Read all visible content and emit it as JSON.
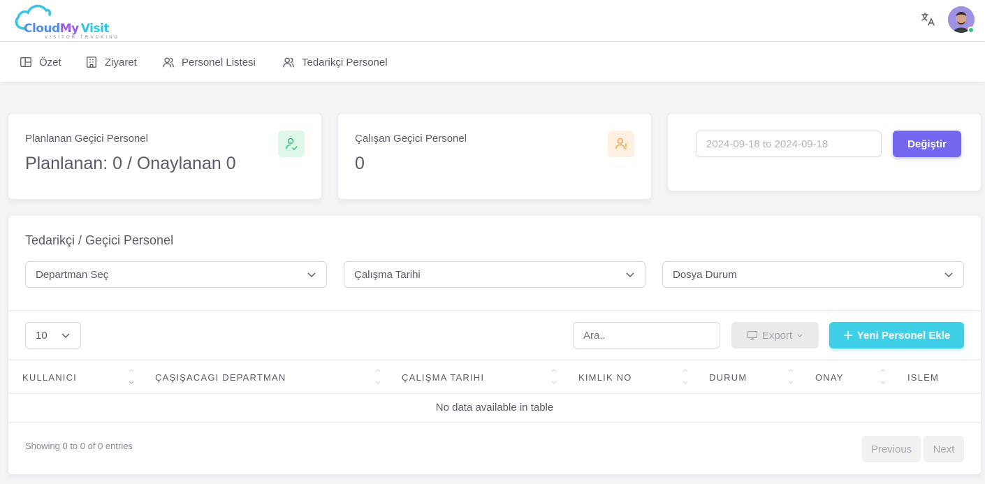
{
  "brand": {
    "name_part1": "Cloud",
    "name_part2": "My",
    "name_part3": "Visit",
    "tagline": "VISITOR TRACKING"
  },
  "header": {
    "translate_icon": "translate-icon",
    "user_status_color": "#28c76f"
  },
  "nav": {
    "items": [
      {
        "label": "Özet",
        "icon": "layout-icon"
      },
      {
        "label": "Ziyaret",
        "icon": "building-icon"
      },
      {
        "label": "Personel Listesi",
        "icon": "users-icon"
      },
      {
        "label": "Tedarikçi Personel",
        "icon": "users-icon"
      }
    ]
  },
  "stats": {
    "planned": {
      "label": "Planlanan Geçici Personel",
      "value": "Planlanan: 0 / Onaylanan 0",
      "icon": "user-check-icon",
      "icon_color": "#28c76f"
    },
    "working": {
      "label": "Çalışan Geçici Personel",
      "value": "0",
      "icon": "user-exclamation-icon",
      "icon_color": "#ff9f43"
    }
  },
  "date_filter": {
    "value": "2024-09-18 to 2024-09-18",
    "button_label": "Değiştir"
  },
  "table_section": {
    "title": "Tedarikçi / Geçici Personel",
    "filters": [
      {
        "label": "Departman Seç"
      },
      {
        "label": "Çalışma Tarihi"
      },
      {
        "label": "Dosya Durum"
      }
    ],
    "page_length": "10",
    "search_placeholder": "Ara..",
    "export_label": "Export",
    "add_label": "Yeni Personel Ekle",
    "columns": [
      "KULLANICI",
      "ÇAŞIŞACAGI DEPARTMAN",
      "ÇALIŞMA TARIHI",
      "KIMLIK NO",
      "DURUM",
      "ONAY",
      "ISLEM"
    ],
    "empty_message": "No data available in table",
    "info": "Showing 0 to 0 of 0 entries",
    "prev_label": "Previous",
    "next_label": "Next"
  },
  "colors": {
    "primary": "#7367f0",
    "info": "#3fd0e8",
    "success": "#28c76f",
    "warning": "#ff9f43"
  }
}
